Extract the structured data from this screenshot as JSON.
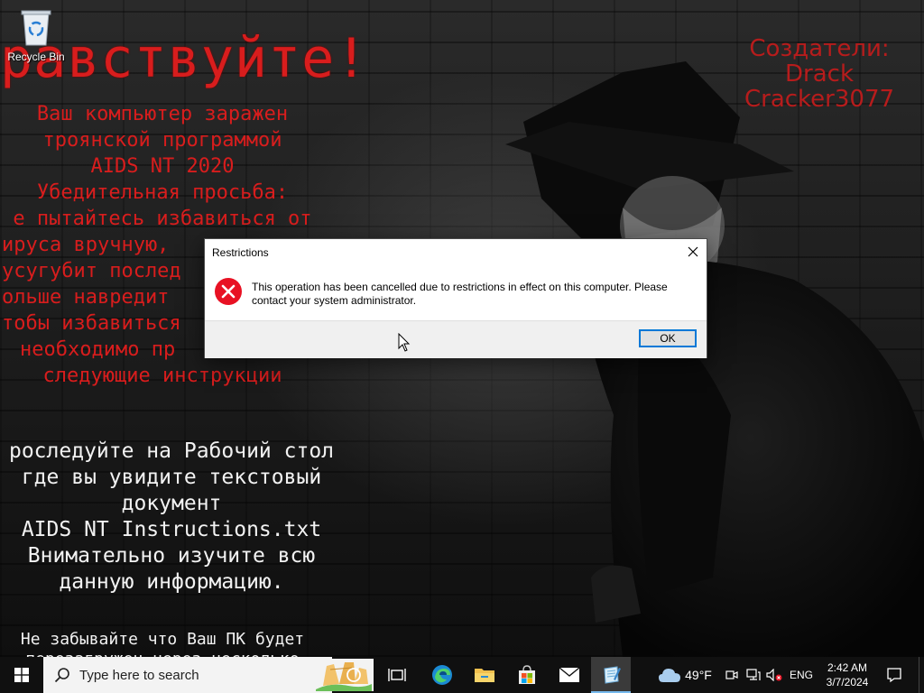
{
  "desktop": {
    "icons": [
      {
        "label": "Recycle Bin"
      }
    ]
  },
  "wallpaper": {
    "greeting": "равствуйте!",
    "creators": [
      "Создатели:",
      "Drack",
      "Cracker3077"
    ],
    "infection_lines": [
      "Ваш компьютер заражен",
      "троянской программой",
      "AIDS NT 2020",
      "Убедительная просьба:",
      "е пытайтесь избавиться от",
      "ируса вручную,",
      "усугубит послед",
      "ольше навредит",
      "тобы избавиться",
      "необходимо пр",
      "следующие инструкции"
    ],
    "instruction_lines": [
      "роследуйте на Рабочий стол",
      "где вы увидите текстовый",
      "документ",
      "AIDS NT Instructions.txt",
      "Внимательно изучите всю",
      "данную информацию."
    ],
    "bottom_lines": [
      "Не забывайте что Ваш ПК будет",
      "перезагружен через несколько"
    ]
  },
  "dialog": {
    "title": "Restrictions",
    "message": "This operation has been cancelled due to restrictions in effect on this computer. Please contact your system administrator.",
    "ok_label": "OK"
  },
  "taskbar": {
    "search_placeholder": "Type here to search",
    "weather": "49°F",
    "language": "ENG",
    "time": "2:42 AM",
    "date": "3/7/2024"
  },
  "colors": {
    "wallpaper_red": "#d81d1d",
    "accent": "#0078d7",
    "error_red": "#e81123"
  }
}
